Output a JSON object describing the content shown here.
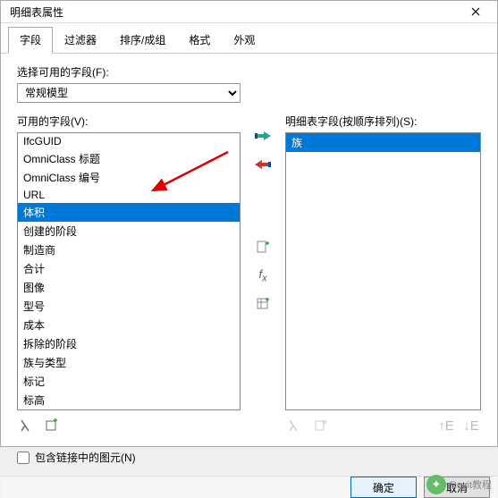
{
  "window": {
    "title": "明细表属性"
  },
  "tabs": [
    "字段",
    "过滤器",
    "排序/成组",
    "格式",
    "外观"
  ],
  "activeTab": 0,
  "labels": {
    "fieldSource": "选择可用的字段(F):",
    "available": "可用的字段(V):",
    "included": "明细表字段(按顺序排列)(S):",
    "includeLinks": "包含链接中的图元(N)"
  },
  "select": {
    "value": "常规模型"
  },
  "availableFields": [
    "IfcGUID",
    "OmniClass 标题",
    "OmniClass 编号",
    "URL",
    "体积",
    "创建的阶段",
    "制造商",
    "合计",
    "图像",
    "型号",
    "成本",
    "拆除的阶段",
    "族与类型",
    "标记",
    "标高"
  ],
  "availableSelected": 4,
  "includedFields": [
    "族"
  ],
  "includedSelected": 0,
  "buttons": {
    "ok": "确定",
    "cancel": "取消"
  },
  "watermark": "Revit教程"
}
